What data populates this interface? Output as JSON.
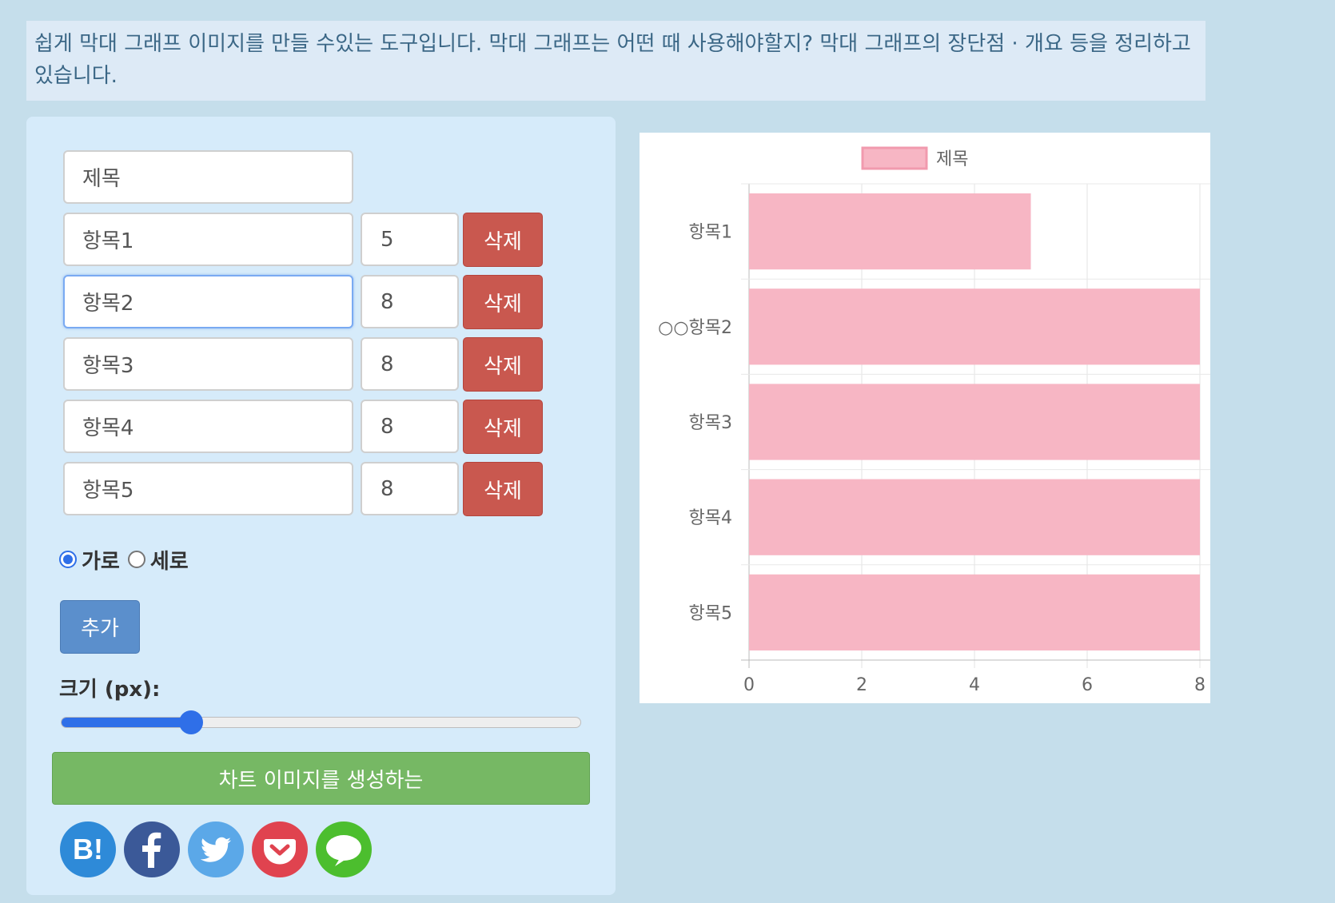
{
  "intro_text": "쉽게 막대 그래프 이미지를 만들 수있는 도구입니다. 막대 그래프는 어떤 때 사용해야할지? 막대 그래프의 장단점 · 개요 등을 정리하고 있습니다.",
  "form": {
    "title_value": "제목",
    "delete_label": "삭제",
    "items": [
      {
        "label": "항목1",
        "value": "5"
      },
      {
        "label": "항목2",
        "value": "8"
      },
      {
        "label": "항목3",
        "value": "8"
      },
      {
        "label": "항목4",
        "value": "8"
      },
      {
        "label": "항목5",
        "value": "8"
      }
    ],
    "orientation": {
      "horizontal": "가로",
      "vertical": "세로",
      "selected": "가로"
    },
    "add_label": "추가",
    "size_label": "크기 (px):",
    "size_slider_fraction": 0.25,
    "generate_label": "차트 이미지를 생성하는"
  },
  "social": [
    "hatena-bookmark-icon",
    "facebook-icon",
    "twitter-icon",
    "pocket-icon",
    "line-message-icon"
  ],
  "colors": {
    "bar_fill": "#f7b6c4",
    "bar_border": "#f19aae",
    "delete_button": "#c9584f",
    "add_button": "#5b8fcc",
    "generate_button": "#76b864"
  },
  "chart_data": {
    "type": "bar",
    "orientation": "horizontal",
    "categories": [
      "항목1",
      "○○항목2",
      "항목3",
      "항목4",
      "항목5"
    ],
    "series": [
      {
        "name": "제목",
        "values": [
          5,
          8,
          8,
          8,
          8
        ]
      }
    ],
    "xlim": [
      0,
      8
    ],
    "x_ticks": [
      "0",
      "2",
      "4",
      "6",
      "8"
    ],
    "grid": true,
    "legend": "top"
  }
}
